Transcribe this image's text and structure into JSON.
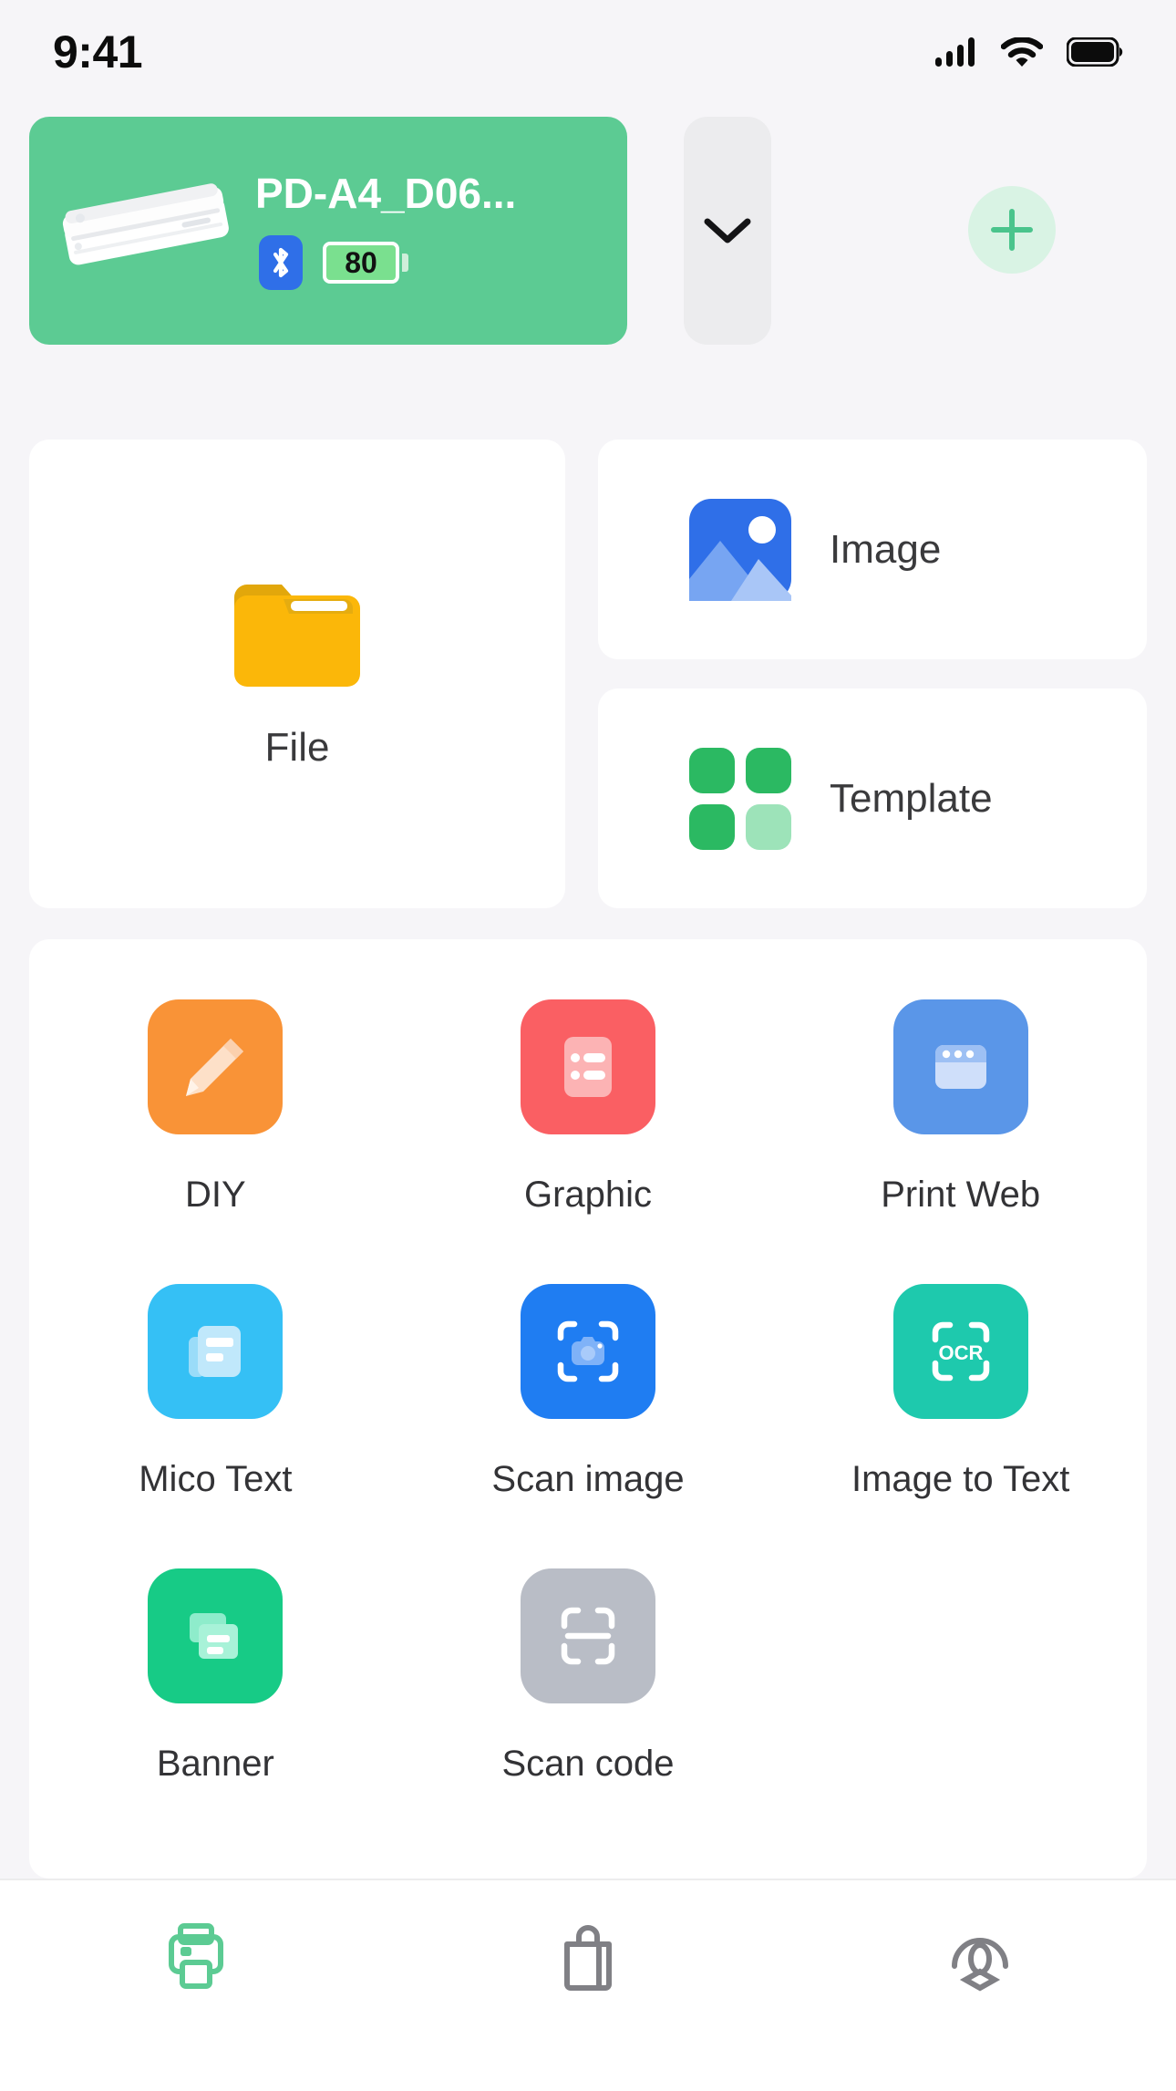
{
  "status_bar": {
    "time": "9:41",
    "signal_icon": "signal-bars-icon",
    "wifi_icon": "wifi-icon",
    "battery_icon": "battery-full-icon"
  },
  "device": {
    "name": "PD-A4_D06...",
    "printer_icon": "printer-device-image",
    "bluetooth_icon": "bluetooth-icon",
    "battery_level": "80",
    "card_color": "#5ccb93",
    "expand_icon": "chevron-down-icon",
    "add_icon": "plus-icon"
  },
  "shortcuts": [
    {
      "label": "File",
      "icon": "folder-icon",
      "color": "#fbb709"
    },
    {
      "label": "Image",
      "icon": "picture-icon",
      "color": "#2f6fe8"
    },
    {
      "label": "Template",
      "icon": "grid-four-icon",
      "color": "#2bb962"
    }
  ],
  "tools": [
    [
      {
        "label": "DIY",
        "icon": "pencil-icon",
        "color": "#f99337"
      },
      {
        "label": "Graphic",
        "icon": "list-card-icon",
        "color": "#fa5f63"
      },
      {
        "label": "Print Web",
        "icon": "browser-window-icon",
        "color": "#5a96e8"
      }
    ],
    [
      {
        "label": "Mico Text",
        "icon": "document-icon",
        "color": "#35c0f5"
      },
      {
        "label": "Scan image",
        "icon": "scan-camera-icon",
        "color": "#1f7df2"
      },
      {
        "label": "Image to Text",
        "icon": "ocr-scan-icon",
        "color": "#1ec9ad"
      }
    ],
    [
      {
        "label": "Banner",
        "icon": "banner-cards-icon",
        "color": "#17cb86"
      },
      {
        "label": "Scan code",
        "icon": "scan-code-icon",
        "color": "#b9bdc6"
      },
      {
        "label": "",
        "icon": "",
        "color": ""
      }
    ]
  ],
  "tabs": [
    {
      "icon": "printer-icon",
      "active": true,
      "color": "#5ccb93"
    },
    {
      "icon": "shopping-bag-icon",
      "active": false,
      "color": "#808085"
    },
    {
      "icon": "user-account-icon",
      "active": false,
      "color": "#808085"
    }
  ]
}
